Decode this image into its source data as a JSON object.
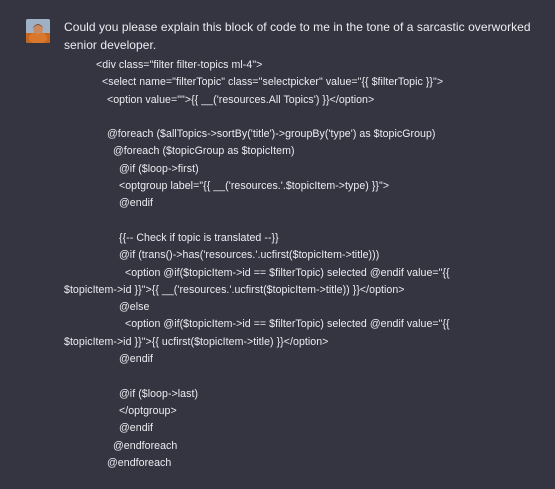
{
  "message": {
    "prompt_lines": [
      "Could you please explain this block of code to me in the tone of a sarcastic overworked",
      "senior developer."
    ],
    "code_lines": [
      "<div class=\"filter filter-topics ml-4\">",
      "<select name=\"filterTopic\" class=\"selectpicker\" value=\"{{ $filterTopic }}\">",
      "<option value=\"\">{{ __('resources.All Topics') }}</option>",
      "",
      "@foreach ($allTopics->sortBy('title')->groupBy('type') as $topicGroup)",
      "@foreach ($topicGroup as $topicItem)",
      "@if ($loop->first)",
      "<optgroup label=\"{{ __('resources.'.$topicItem->type) }}\">",
      "@endif",
      "",
      "{{-- Check if topic is translated --}}",
      "@if (trans()->has('resources.'.ucfirst($topicItem->title)))",
      "<option @if($topicItem->id == $filterTopic) selected @endif value=\"{{",
      "$topicItem->id }}\">{{ __('resources.'.ucfirst($topicItem->title)) }}</option>",
      "@else",
      "<option @if($topicItem->id == $filterTopic) selected @endif value=\"{{",
      "$topicItem->id }}\">{{ ucfirst($topicItem->title) }}</option>",
      "@endif",
      "",
      "@if ($loop->last)",
      "</optgroup>",
      "@endif",
      "@endforeach",
      "@endforeach"
    ]
  },
  "colors": {
    "background": "#343541",
    "text": "#ececf1"
  }
}
